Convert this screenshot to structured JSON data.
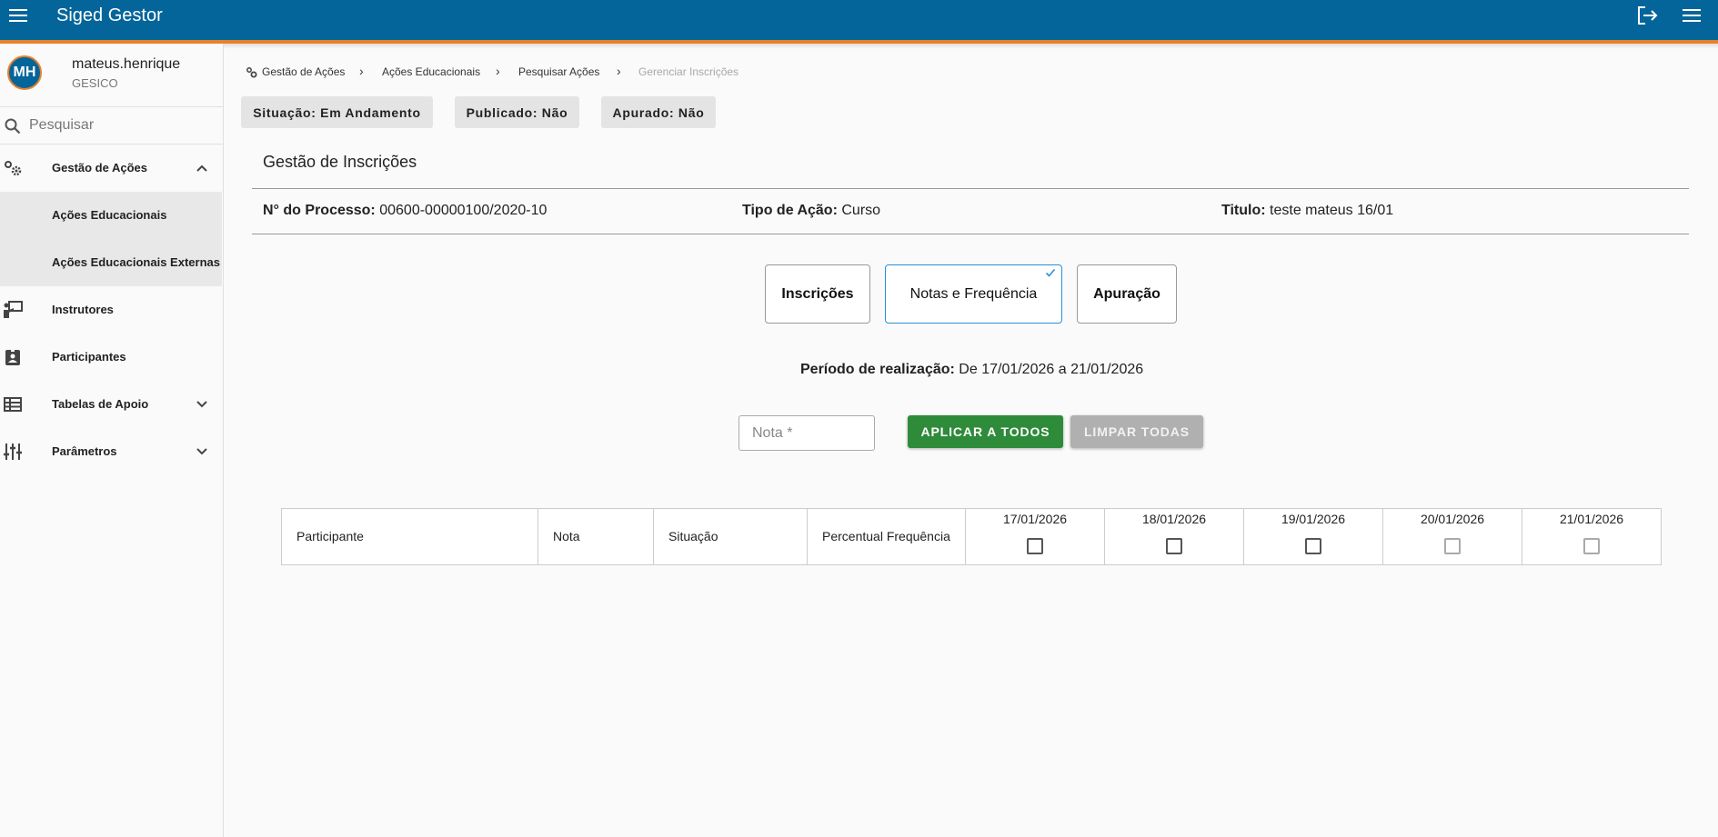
{
  "app": {
    "title": "Siged Gestor"
  },
  "colors": {
    "primary": "#04659a",
    "accent": "#e8812c",
    "success": "#2e8b3a",
    "selected_border": "#2b8fd6"
  },
  "user": {
    "initials": "MH",
    "name": "mateus.henrique",
    "org": "GESICO"
  },
  "sidebar": {
    "search_placeholder": "Pesquisar",
    "items": [
      {
        "label": "Gestão de Ações",
        "icon": "gears-icon",
        "expanded": true
      },
      {
        "label": "Ações Educacionais",
        "sub": true
      },
      {
        "label": "Ações Educacionais Externas",
        "sub": true
      },
      {
        "label": "Instrutores",
        "icon": "instructor-icon"
      },
      {
        "label": "Participantes",
        "icon": "badge-icon"
      },
      {
        "label": "Tabelas de Apoio",
        "icon": "table-icon",
        "expanded": false
      },
      {
        "label": "Parâmetros",
        "icon": "sliders-icon",
        "expanded": false
      }
    ]
  },
  "breadcrumb": [
    "Gestão de Ações",
    "Ações Educacionais",
    "Pesquisar Ações",
    "Gerenciar Inscrições"
  ],
  "status_chips": [
    "Situação: Em Andamento",
    "Publicado: Não",
    "Apurado: Não"
  ],
  "page": {
    "title": "Gestão de Inscrições",
    "process_label": "N° do Processo:",
    "process_value": "00600-00000100/2020-10",
    "type_label": "Tipo de Ação:",
    "type_value": "Curso",
    "title_label": "Titulo:",
    "title_value": "teste mateus 16/01"
  },
  "tabs": [
    {
      "label": "Inscrições",
      "selected": false
    },
    {
      "label": "Notas e Frequência",
      "selected": true
    },
    {
      "label": "Apuração",
      "selected": false
    }
  ],
  "period": {
    "label": "Período de realização:",
    "value": "De 17/01/2026 a 21/01/2026"
  },
  "nota": {
    "placeholder": "Nota *",
    "value": ""
  },
  "buttons": {
    "apply_all": "APLICAR A TODOS",
    "clear_all": "LIMPAR TODAS"
  },
  "table": {
    "columns": [
      "Participante",
      "Nota",
      "Situação",
      "Percentual Frequência"
    ],
    "dates": [
      "17/01/2026",
      "18/01/2026",
      "19/01/2026",
      "20/01/2026",
      "21/01/2026"
    ],
    "rows": []
  }
}
